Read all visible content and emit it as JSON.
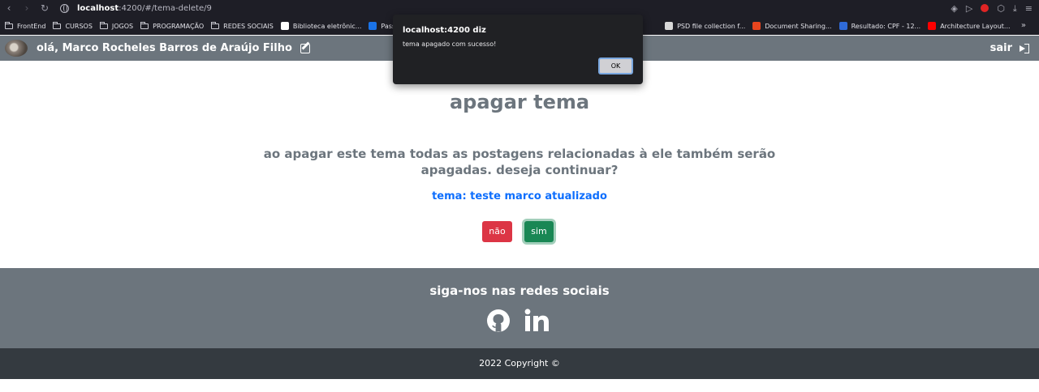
{
  "browser": {
    "url_host": "localhost",
    "url_path": ":4200/#/tema-delete/9",
    "bookmarks": [
      {
        "label": "FrontEnd",
        "kind": "folder"
      },
      {
        "label": "CURSOS",
        "kind": "folder"
      },
      {
        "label": "JOGOS",
        "kind": "folder"
      },
      {
        "label": "PROGRAMAÇÃO",
        "kind": "folder"
      },
      {
        "label": "REDES SOCIAIS",
        "kind": "folder"
      },
      {
        "label": "Biblioteca eletrônic...",
        "kind": "site",
        "color": "#ffffff"
      },
      {
        "label": "Passagen",
        "kind": "site",
        "color": "#1a73e8"
      },
      {
        "label": "PSD file collection f...",
        "kind": "site",
        "color": "#d8d8d8"
      },
      {
        "label": "Document Sharing...",
        "kind": "site",
        "color": "#e8451e"
      },
      {
        "label": "Resultado: CPF - 12...",
        "kind": "site",
        "color": "#2f6ad8"
      },
      {
        "label": "Architecture Layout...",
        "kind": "site",
        "color": "#ff0000"
      }
    ],
    "more": "»"
  },
  "navbar": {
    "greeting": "olá, Marco Rocheles Barros de Araújo Filho",
    "logout_label": "sair"
  },
  "main": {
    "title": "apagar tema",
    "warning": "ao apagar este tema todas as postagens relacionadas à ele também serão apagadas. deseja continuar?",
    "topic": "tema: teste marco atualizado",
    "no_label": "não",
    "yes_label": "sim"
  },
  "footer": {
    "title": "siga-nos nas redes sociais",
    "copyright": "2022 Copyright ©"
  },
  "dialog": {
    "title": "localhost:4200 diz",
    "message": "tema apagado com sucesso!",
    "ok_label": "OK"
  },
  "colors": {
    "navbar": "#6c757d",
    "danger": "#dc3545",
    "success": "#198754",
    "link": "#0d6efd",
    "footer_dark": "#343a40"
  }
}
